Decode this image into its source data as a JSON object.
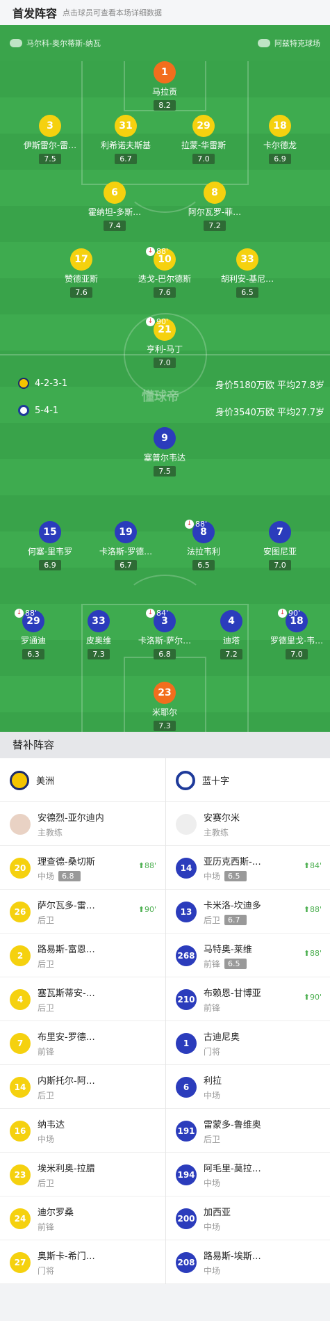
{
  "header": {
    "title": "首发阵容",
    "subtitle": "点击球员可查看本场详细数据"
  },
  "topbar": {
    "referee": "马尔科-奥尔蒂斯-纳瓦",
    "stadium": "阿兹特克球场"
  },
  "home": {
    "formation": "4-2-3-1",
    "value": "身价5180万欧 平均27.8岁"
  },
  "away": {
    "formation": "5-4-1",
    "value": "身价3540万欧 平均27.7岁"
  },
  "watermark": "懂球帝",
  "home_players": [
    {
      "num": "1",
      "name": "马拉贡",
      "rating": "8.2",
      "color": "o"
    },
    {
      "num": "3",
      "name": "伊斯雷尔-雷…",
      "rating": "7.5",
      "color": "y",
      "card": true
    },
    {
      "num": "31",
      "name": "利希诺夫斯基",
      "rating": "6.7",
      "color": "y"
    },
    {
      "num": "29",
      "name": "拉蒙-华雷斯",
      "rating": "7.0",
      "color": "y"
    },
    {
      "num": "18",
      "name": "卡尔德龙",
      "rating": "6.9",
      "color": "y"
    },
    {
      "num": "6",
      "name": "霍纳坦-多斯…",
      "rating": "7.4",
      "color": "y"
    },
    {
      "num": "8",
      "name": "阿尔瓦罗-菲…",
      "rating": "7.2",
      "color": "y"
    },
    {
      "num": "17",
      "name": "赞德亚斯",
      "rating": "7.6",
      "color": "y"
    },
    {
      "num": "10",
      "name": "迭戈-巴尔德斯",
      "rating": "7.6",
      "color": "y",
      "sub": "88'"
    },
    {
      "num": "33",
      "name": "胡利安-基尼…",
      "rating": "6.5",
      "color": "y",
      "card": true
    },
    {
      "num": "21",
      "name": "亨利-马丁",
      "rating": "7.0",
      "color": "y",
      "card": true,
      "sub": "90'"
    }
  ],
  "away_players": [
    {
      "num": "9",
      "name": "塞普尔韦达",
      "rating": "7.5",
      "color": "b"
    },
    {
      "num": "15",
      "name": "何塞-里韦罗",
      "rating": "6.9",
      "color": "b"
    },
    {
      "num": "19",
      "name": "卡洛斯-罗德…",
      "rating": "6.7",
      "color": "b"
    },
    {
      "num": "8",
      "name": "法拉韦利",
      "rating": "6.5",
      "color": "b",
      "sub": "88'"
    },
    {
      "num": "7",
      "name": "安图尼亚",
      "rating": "7.0",
      "color": "b"
    },
    {
      "num": "29",
      "name": "罗通迪",
      "rating": "6.3",
      "color": "b",
      "card": true,
      "sub": "88'"
    },
    {
      "num": "33",
      "name": "皮奥维",
      "rating": "7.3",
      "color": "b"
    },
    {
      "num": "3",
      "name": "卡洛斯-萨尔…",
      "rating": "6.8",
      "color": "b",
      "sub": "84'"
    },
    {
      "num": "4",
      "name": "迪塔",
      "rating": "7.2",
      "color": "b"
    },
    {
      "num": "18",
      "name": "罗德里戈-韦…",
      "rating": "7.0",
      "color": "b",
      "sub": "90'"
    },
    {
      "num": "23",
      "name": "米耶尔",
      "rating": "7.3",
      "color": "o"
    }
  ],
  "subs_title": "替补阵容",
  "teams": {
    "home": "美洲",
    "away": "蓝十字"
  },
  "coaches": {
    "home": {
      "name": "安德烈-亚尔迪内",
      "role": "主教练"
    },
    "away": {
      "name": "安赛尔米",
      "role": "主教练"
    }
  },
  "subs": [
    [
      {
        "num": "20",
        "name": "理查德-桑切斯",
        "pos": "中场",
        "rating": "6.8",
        "min": "88'"
      },
      {
        "num": "14",
        "name": "亚历克西斯-…",
        "pos": "中场",
        "rating": "6.5",
        "min": "84'"
      }
    ],
    [
      {
        "num": "26",
        "name": "萨尔瓦多-雷…",
        "pos": "后卫",
        "min": "90'"
      },
      {
        "num": "13",
        "name": "卡米洛-坎迪多",
        "pos": "后卫",
        "rating": "6.7",
        "min": "88'"
      }
    ],
    [
      {
        "num": "2",
        "name": "路易斯-富恩…",
        "pos": "后卫"
      },
      {
        "num": "268",
        "name": "马特奥-莱维",
        "pos": "前锋",
        "rating": "6.5",
        "min": "88'"
      }
    ],
    [
      {
        "num": "4",
        "name": "塞瓦斯蒂安-…",
        "pos": "后卫"
      },
      {
        "num": "210",
        "name": "布赖恩-甘博亚",
        "pos": "前锋",
        "min": "90'"
      }
    ],
    [
      {
        "num": "7",
        "name": "布里安-罗德…",
        "pos": "前锋"
      },
      {
        "num": "1",
        "name": "古迪尼奥",
        "pos": "门将"
      }
    ],
    [
      {
        "num": "14",
        "name": "内斯托尔-阿…",
        "pos": "后卫"
      },
      {
        "num": "6",
        "name": "利拉",
        "pos": "中场"
      }
    ],
    [
      {
        "num": "16",
        "name": "纳韦达",
        "pos": "中场"
      },
      {
        "num": "191",
        "name": "雷蒙多-鲁维奥",
        "pos": "后卫"
      }
    ],
    [
      {
        "num": "23",
        "name": "埃米利奥-拉腊",
        "pos": "后卫"
      },
      {
        "num": "194",
        "name": "阿毛里-莫拉…",
        "pos": "中场"
      }
    ],
    [
      {
        "num": "24",
        "name": "迪尔罗桑",
        "pos": "前锋"
      },
      {
        "num": "200",
        "name": "加西亚",
        "pos": "中场"
      }
    ],
    [
      {
        "num": "27",
        "name": "奥斯卡-希门…",
        "pos": "门将"
      },
      {
        "num": "208",
        "name": "路易斯-埃斯…",
        "pos": "中场"
      }
    ]
  ]
}
